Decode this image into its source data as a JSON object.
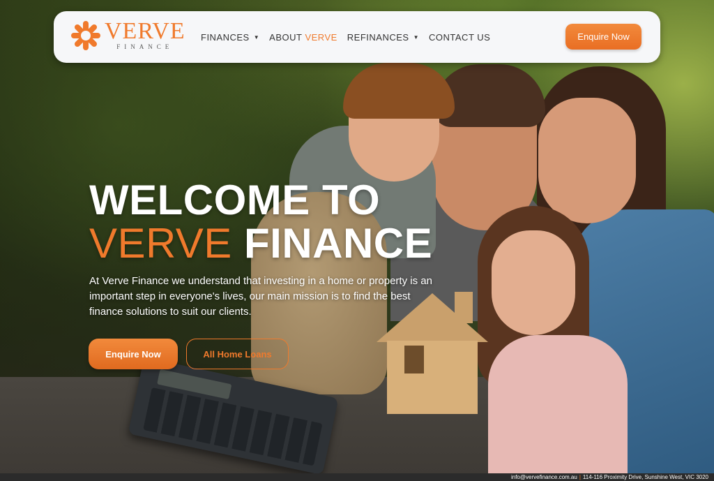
{
  "brand": {
    "logo_word": "VERVE",
    "logo_sub": "FINANCE",
    "accent_color": "#f07a2c"
  },
  "nav": {
    "items": [
      {
        "label": "FINANCES",
        "has_dropdown": true
      },
      {
        "label": "ABOUT",
        "accent": "VERVE",
        "has_dropdown": false
      },
      {
        "label": "REFINANCES",
        "has_dropdown": true
      },
      {
        "label": "CONTACT US",
        "has_dropdown": false
      }
    ],
    "cta_label": "Enquire Now"
  },
  "hero": {
    "title_line1": "WELCOME TO",
    "title_brand": "VERVE",
    "title_rest": " FINANCE",
    "description": "At Verve Finance we understand that investing in a home or property is an important step in everyone's lives, our main mission is to find the best finance solutions to suit our clients.",
    "primary_button": "Enquire Now",
    "secondary_button": "All Home Loans"
  },
  "footer": {
    "email": "info@vervefinance.com.au",
    "separator": "|",
    "address": "114-116 Proximity Drive, Sunshine West, VIC 3020"
  }
}
